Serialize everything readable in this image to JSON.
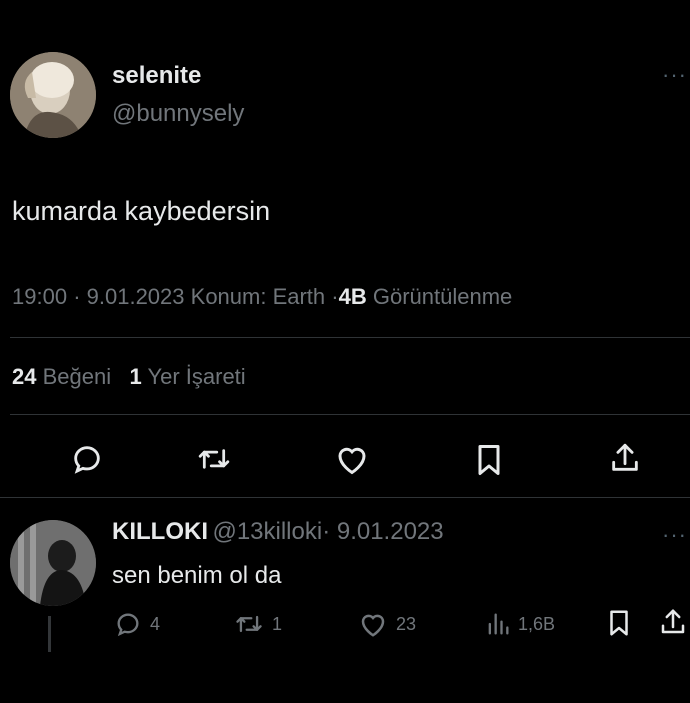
{
  "tweet": {
    "display_name": "selenite",
    "handle": "@bunnysely",
    "more_label": "···",
    "text": "kumarda kaybedersin",
    "time": "19:00",
    "date": "9.01.2023",
    "location": "Konum: Earth",
    "views_count": "4B",
    "views_label": "Görüntülenme",
    "sep": "·",
    "likes_count": "24",
    "likes_label": "Beğeni",
    "bookmarks_count": "1",
    "bookmarks_label": "Yer İşareti",
    "actions": [
      "reply-icon",
      "retweet-icon",
      "heart-icon",
      "bookmark-icon",
      "share-icon"
    ]
  },
  "reply": {
    "display_name": "KILLOKI",
    "handle": "@13killoki",
    "date": "· 9.01.2023",
    "more_label": "···",
    "text": "sen benim ol da",
    "reply_count": "4",
    "retweet_count": "1",
    "like_count": "23",
    "views_count": "1,6B"
  },
  "colors": {
    "background": "#000000",
    "text_primary": "#e7e9ea",
    "text_secondary": "#71767b",
    "divider": "#2f3336"
  }
}
